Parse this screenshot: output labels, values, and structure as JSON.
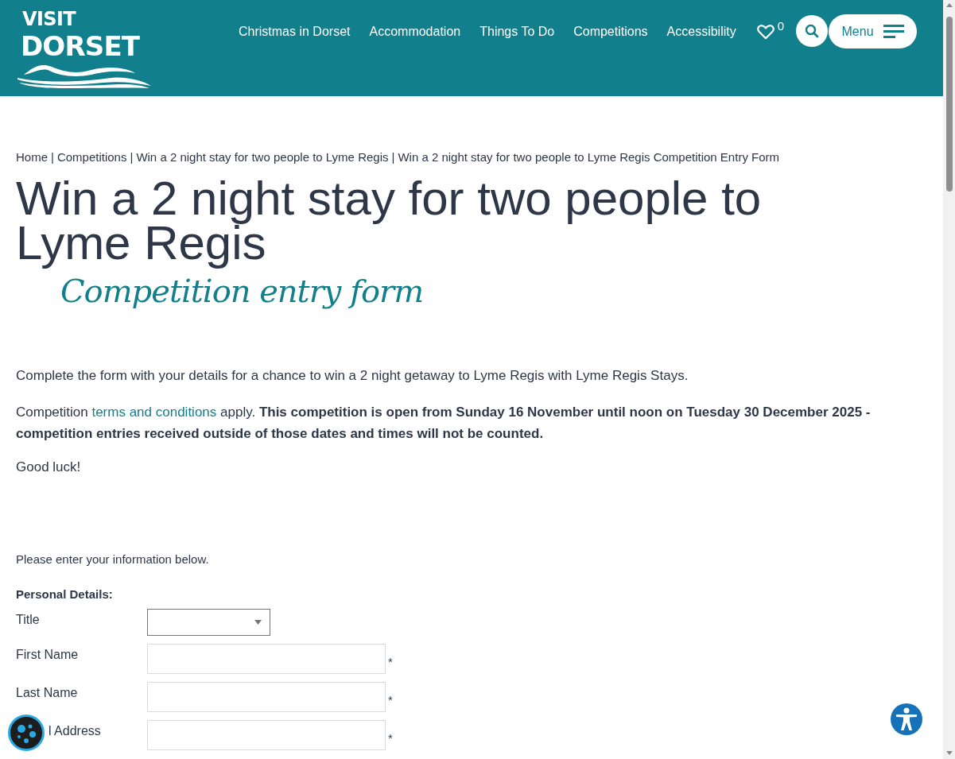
{
  "header": {
    "logo": {
      "top": "VISIT",
      "bottom": "DORSET"
    },
    "nav": [
      "Christmas in Dorset",
      "Accommodation",
      "Things To Do",
      "Competitions",
      "Accessibility"
    ],
    "favourites_count": "0",
    "menu_label": "Menu"
  },
  "breadcrumb": {
    "separator": "|",
    "items": [
      "Home",
      "Competitions",
      "Win a 2 night stay for two people to Lyme Regis",
      "Win a 2 night stay for two people to Lyme Regis Competition Entry Form"
    ]
  },
  "title": "Win a 2 night stay for two people to Lyme Regis",
  "subtitle": "Competition entry form",
  "intro": "Complete the form with your details for a chance to win a 2 night getaway to Lyme Regis with Lyme Regis Stays.",
  "terms": {
    "before": "Competition ",
    "link": "terms and conditions",
    "after": " apply. **This competition is open from Sunday 16 November until noon on Tuesday 30 December 2025 - competition entries received outside of those dates and times will not be counted.**"
  },
  "good_luck": "Good luck!",
  "form": {
    "instructions": "Please enter your information below.",
    "section": "Personal Details:",
    "fields": [
      {
        "label": "Title",
        "kind": "select"
      },
      {
        "label": "First Name",
        "kind": "text",
        "required_mark": "*"
      },
      {
        "label": "Last Name",
        "kind": "text",
        "required_mark": "*"
      },
      {
        "label": "l Address",
        "kind": "text",
        "required_mark": "*"
      }
    ]
  }
}
